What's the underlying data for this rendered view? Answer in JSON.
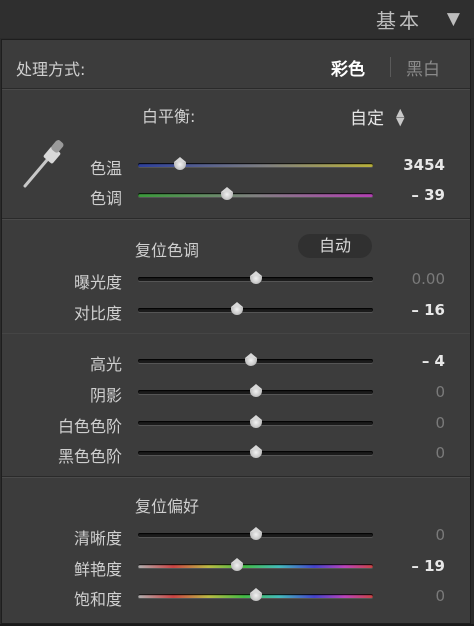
{
  "header": {
    "title": "基本",
    "collapse_icon": "triangle-down-icon"
  },
  "treatment": {
    "label": "处理方式:",
    "options": [
      "彩色",
      "黑白"
    ],
    "selected": "彩色"
  },
  "white_balance": {
    "label": "白平衡:",
    "preset": "自定",
    "eyedropper_icon": "eyedropper-icon",
    "temp": {
      "label": "色温",
      "value": "3454",
      "fraction": 0.18
    },
    "tint": {
      "label": "色调",
      "value": "– 39",
      "fraction": 0.38
    }
  },
  "tone": {
    "reset_label": "复位色调",
    "auto_label": "自动",
    "exposure": {
      "label": "曝光度",
      "value": "0.00",
      "fraction": 0.5
    },
    "contrast": {
      "label": "对比度",
      "value": "– 16",
      "fraction": 0.42
    },
    "highlights": {
      "label": "高光",
      "value": "– 4",
      "fraction": 0.48
    },
    "shadows": {
      "label": "阴影",
      "value": "0",
      "fraction": 0.5
    },
    "whites": {
      "label": "白色色阶",
      "value": "0",
      "fraction": 0.5
    },
    "blacks": {
      "label": "黑色色阶",
      "value": "0",
      "fraction": 0.5
    }
  },
  "presence": {
    "reset_label": "复位偏好",
    "clarity": {
      "label": "清晰度",
      "value": "0",
      "fraction": 0.5
    },
    "vibrance": {
      "label": "鲜艳度",
      "value": "– 19",
      "fraction": 0.42
    },
    "saturation": {
      "label": "饱和度",
      "value": "0",
      "fraction": 0.5
    }
  }
}
